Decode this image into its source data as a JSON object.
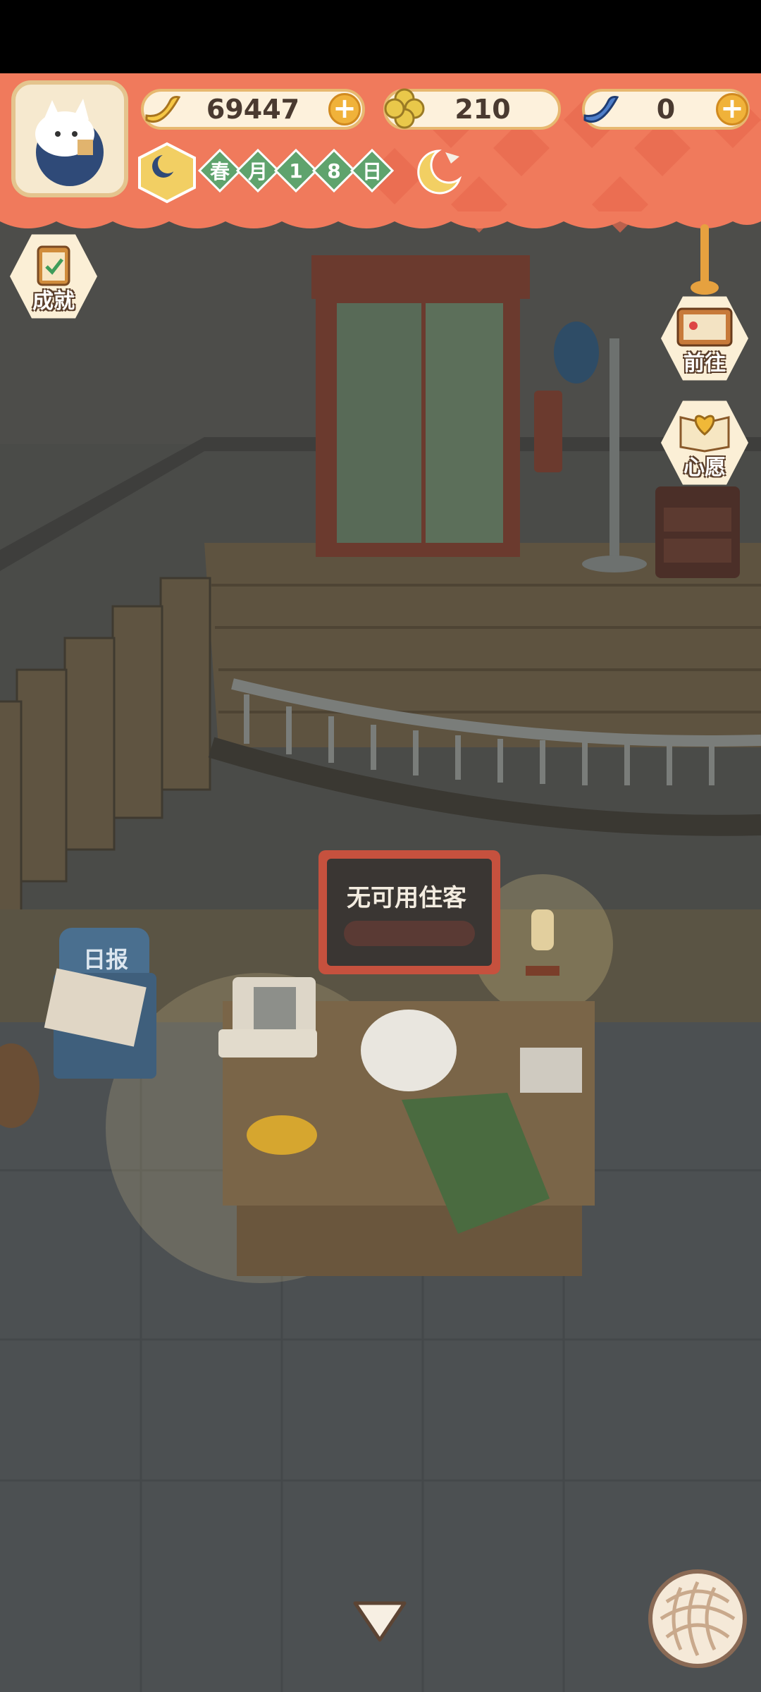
{
  "resources": {
    "bananas": "69447",
    "clovers": "210",
    "blue_bananas": "0"
  },
  "date": {
    "season": "春",
    "month_label": "月",
    "day_digit_1": "1",
    "day_digit_2": "8",
    "day_label": "日"
  },
  "side_buttons": {
    "achievements": "成就",
    "go_to": "前往",
    "wish": "心愿"
  },
  "scene": {
    "reception_sign": "无可用住客",
    "newspaper_sign": "日报"
  },
  "icons": {
    "banana": "banana-icon",
    "clover": "clover-icon",
    "blue_banana": "blue-banana-icon",
    "moon": "moon-icon",
    "sleep_moon": "sleeping-moon-icon",
    "yarn": "yarn-ball-icon",
    "down": "triangle-down-icon"
  },
  "colors": {
    "hud_banner": "#f07a5c",
    "pill_border": "#e7b870",
    "date_diamond": "#5fa36d",
    "plus_button": "#f0b23a"
  }
}
